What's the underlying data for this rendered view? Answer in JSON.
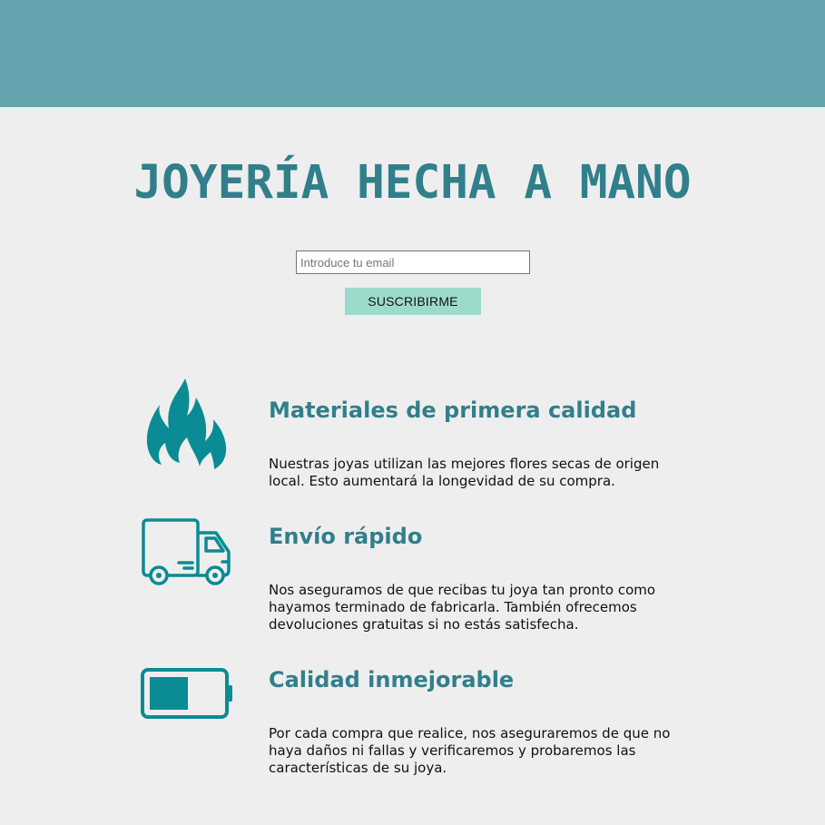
{
  "colors": {
    "header": "#65a3ae",
    "accent": "#317f8b",
    "icon": "#0b8b93",
    "button": "#9cdbcb",
    "background": "#eeeeee"
  },
  "hero": {
    "title": "JOYERÍA HECHA A MANO"
  },
  "subscribe": {
    "email_placeholder": "Introduce tu email",
    "button_label": "SUSCRIBIRME"
  },
  "features": [
    {
      "icon": "fire-icon",
      "title": "Materiales de primera calidad",
      "text": "Nuestras joyas utilizan las mejores flores secas de origen local. Esto aumentará la longevidad de su compra."
    },
    {
      "icon": "truck-icon",
      "title": "Envío rápido",
      "text": "Nos aseguramos de que recibas tu joya tan pronto como hayamos terminado de fabricarla. También ofrecemos devoluciones gratuitas si no estás satisfecha."
    },
    {
      "icon": "battery-icon",
      "title": "Calidad inmejorable",
      "text": "Por cada compra que realice, nos aseguraremos de que no haya daños ni fallas y verificaremos y probaremos las características de su joya."
    }
  ]
}
